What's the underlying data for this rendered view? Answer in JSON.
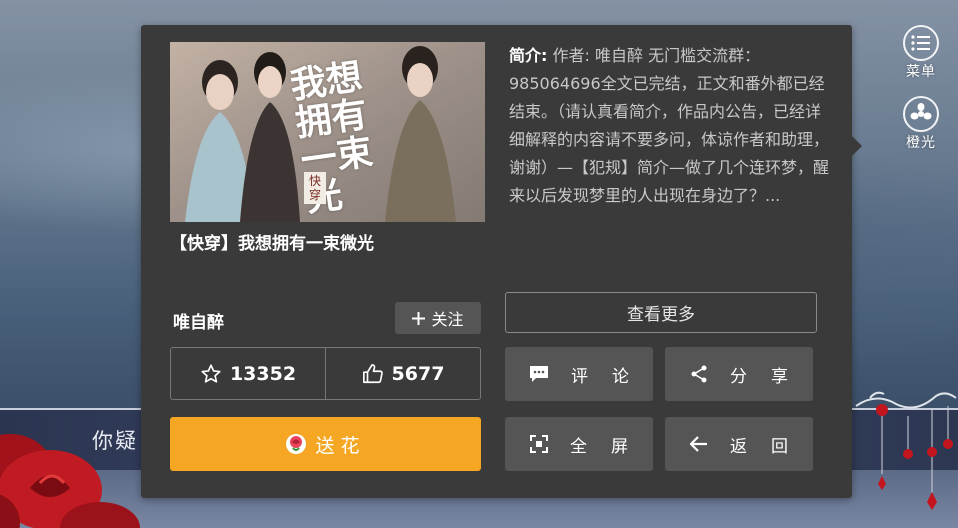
{
  "background": {
    "banner_text": "你疑"
  },
  "side_menu": [
    {
      "label": "菜单",
      "icon": "list-icon"
    },
    {
      "label": "橙光",
      "icon": "orange-logo-icon"
    }
  ],
  "book": {
    "title": "【快穿】我想拥有一束微光",
    "cover_title_chars": "我想拥有一束光",
    "cover_tag": "快穿",
    "intro_label": "简介:",
    "intro_text": "作者: 唯自醉 无门槛交流群：985064696全文已完结，正文和番外都已经结束。（请认真看简介，作品内公告，已经详细解释的内容请不要多问，体谅作者和助理，谢谢）—【犯规】简介—做了几个连环梦，醒来以后发现梦里的人出现在身边了？..."
  },
  "author": {
    "name": "唯自醉",
    "follow_label": "关注"
  },
  "stats": {
    "stars": "13352",
    "likes": "5677"
  },
  "buttons": {
    "send_flower": "送花",
    "view_more": "查看更多",
    "comment": "评论",
    "share": "分享",
    "fullscreen": "全屏",
    "back": "返回"
  },
  "colors": {
    "panel_bg": "#3a3a3a",
    "button_bg": "#555555",
    "flower_accent": "#f5a623"
  }
}
